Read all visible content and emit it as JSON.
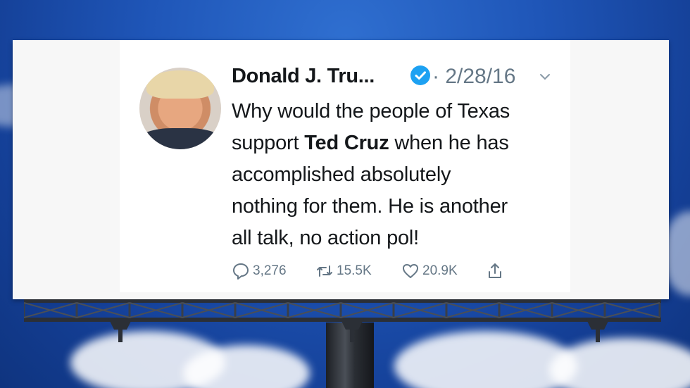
{
  "tweet": {
    "author": "Donald J. Tru...",
    "date": "· 2/28/16",
    "body_lines": [
      {
        "pre": "Why would the people of Texas",
        "bold": "",
        "post": ""
      },
      {
        "pre": "support ",
        "bold": "Ted Cruz",
        "post": " when he has"
      },
      {
        "pre": "accomplished absolutely",
        "bold": "",
        "post": ""
      },
      {
        "pre": "nothing for them. He is another",
        "bold": "",
        "post": ""
      },
      {
        "pre": "all talk, no action pol!",
        "bold": "",
        "post": ""
      }
    ],
    "replies": "3,276",
    "retweets": "15.5K",
    "likes": "20.9K"
  },
  "icons": {
    "verified": "verified-badge-icon",
    "menu": "chevron-down-icon",
    "reply": "reply-icon",
    "retweet": "retweet-icon",
    "like": "heart-icon",
    "share": "share-icon"
  },
  "colors": {
    "verified_blue": "#1da1f2",
    "text_dark": "#14171a",
    "text_gray": "#657786",
    "sky": "#1f56b8"
  }
}
